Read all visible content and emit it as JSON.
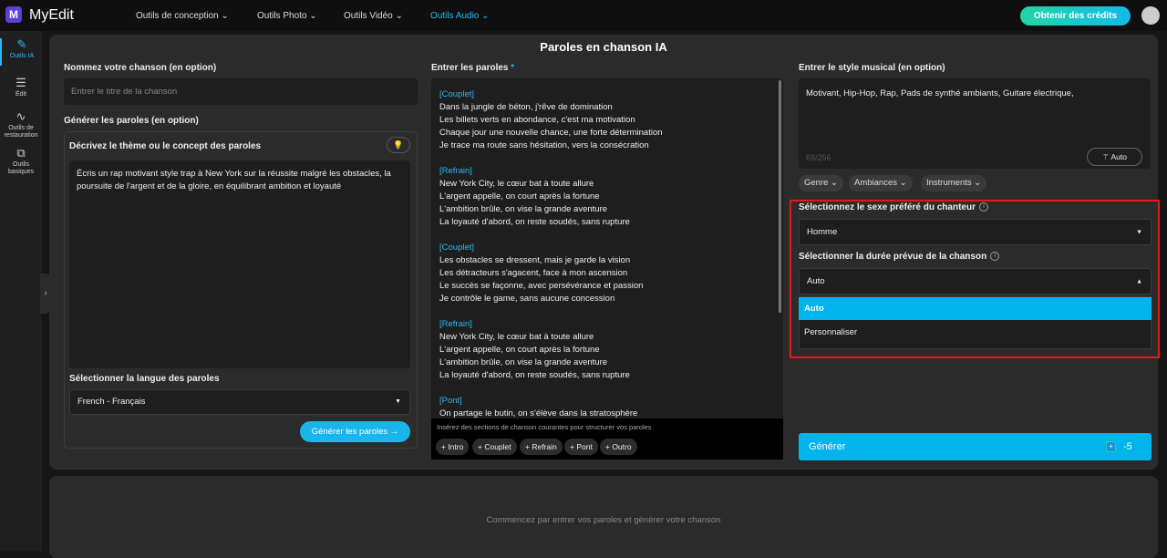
{
  "app": {
    "logo": "M",
    "name": "MyEdit"
  },
  "nav": [
    {
      "label": "Outils de conception ⌄"
    },
    {
      "label": "Outils Photo ⌄"
    },
    {
      "label": "Outils Vidéo ⌄"
    },
    {
      "label": "Outils Audio ⌄"
    }
  ],
  "credits_button": "Obtenir des crédits",
  "sidebar": [
    {
      "icon": "✎",
      "label": "Outils IA"
    },
    {
      "icon": "☰",
      "label": "Édit"
    },
    {
      "icon": "∿",
      "label": "Outils de restauration"
    },
    {
      "icon": "⧉",
      "label": "Outils basiques"
    }
  ],
  "page_title": "Paroles en chanson IA",
  "left": {
    "name_label": "Nommez votre chanson (en option)",
    "name_placeholder": "Entrer le titre de la chanson",
    "gen_label": "Générer les paroles (en option)",
    "theme_label": "Décrivez le thème ou le concept des paroles",
    "theme_text": "Écris un rap motivant style trap à New York sur la réussite malgré les obstacles, la poursuite de l'argent et de la gloire, en équilibrant ambition et loyauté",
    "lang_label": "Sélectionner la langue des paroles",
    "lang_value": "French - Français",
    "gen_button": "Générer les paroles →"
  },
  "lyrics": {
    "label": "Entrer les paroles",
    "required": "*",
    "sections": [
      {
        "tag": "[Couplet]",
        "lines": [
          "Dans la jungle de béton, j'rêve de domination",
          "Les billets verts en abondance, c'est ma motivation",
          "Chaque jour une nouvelle chance, une forte détermination",
          "Je trace ma route sans hésitation, vers la consécration"
        ]
      },
      {
        "tag": "[Refrain]",
        "lines": [
          "New York City, le cœur bat à toute allure",
          "L'argent appelle, on court après la fortune",
          "L'ambition brûle, on vise la grande aventure",
          "La loyauté d'abord, on reste soudés, sans rupture"
        ]
      },
      {
        "tag": "[Couplet]",
        "lines": [
          "Les obstacles se dressent, mais je garde la vision",
          "Les détracteurs s'agacent, face à mon ascension",
          "Le succès se façonne, avec persévérance et passion",
          "Je contrôle le game, sans aucune concession"
        ]
      },
      {
        "tag": "[Refrain]",
        "lines": [
          "New York City, le cœur bat à toute allure",
          "L'argent appelle, on court après la fortune",
          "L'ambition brûle, on vise la grande aventure",
          "La loyauté d'abord, on reste soudés, sans rupture"
        ]
      },
      {
        "tag": "[Pont]",
        "lines": [
          "On partage le butin, on s'élève dans la stratosphère"
        ]
      }
    ],
    "insert_hint": "Insérez des sections de chanson courantes pour structurer vos paroles",
    "chips": [
      "+ Intro",
      "+ Couplet",
      "+ Refrain",
      "+ Pont",
      "+ Outro"
    ]
  },
  "right": {
    "style_label": "Entrer le style musical (en option)",
    "style_text": "Motivant, Hip-Hop, Rap, Pads de synthé ambiants, Guitare électrique,",
    "counter": "69/256",
    "auto_button": "Auto",
    "filters": [
      "Genre ⌄",
      "Ambiances ⌄",
      "Instruments ⌄"
    ],
    "gender_label": "Sélectionnez le sexe préféré du chanteur",
    "gender_value": "Homme",
    "duration_label": "Sélectionner la durée prévue de la chanson",
    "duration_value": "Auto",
    "duration_options": [
      "Auto",
      "Personnaliser"
    ],
    "generate_button": "Générer",
    "cost": "-5"
  },
  "bottom_hint": "Commencez par entrer vos paroles et générer votre chanson",
  "colors": {
    "accent": "#00b4ec",
    "highlight_box": "#e01b1b",
    "brand": "#5b3fd6"
  }
}
